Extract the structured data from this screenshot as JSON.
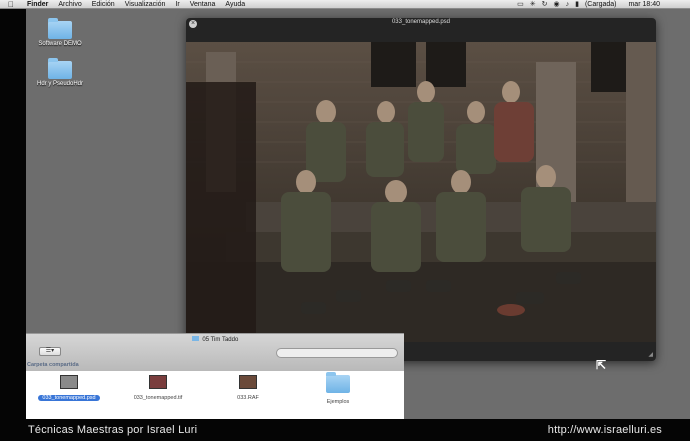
{
  "menubar": {
    "apple_icon": "apple-icon",
    "app": "Finder",
    "items": [
      "Archivo",
      "Edición",
      "Visualización",
      "Ir",
      "Ventana",
      "Ayuda"
    ],
    "battery_label": "(Cargada)",
    "clock": "mar 18:40"
  },
  "desktop": {
    "icons": [
      {
        "label": "Software DEMO"
      },
      {
        "label": "Hdr y PseudoHdr"
      }
    ]
  },
  "quicklook": {
    "title": "033_tonemapped.psd"
  },
  "finder": {
    "title": "05 Tim Taddo",
    "sidebar_section": "Carpeta compartida",
    "items": [
      {
        "name": "033_tonemapped.psd",
        "selected": true
      },
      {
        "name": "033_tonemapped.tif",
        "selected": false
      },
      {
        "name": "033.RAF",
        "selected": false
      },
      {
        "name": "Ejemplos",
        "selected": false
      }
    ]
  },
  "caption": {
    "left": "Técnicas Maestras por Israel Luri",
    "right": "http://www.israelluri.es"
  }
}
